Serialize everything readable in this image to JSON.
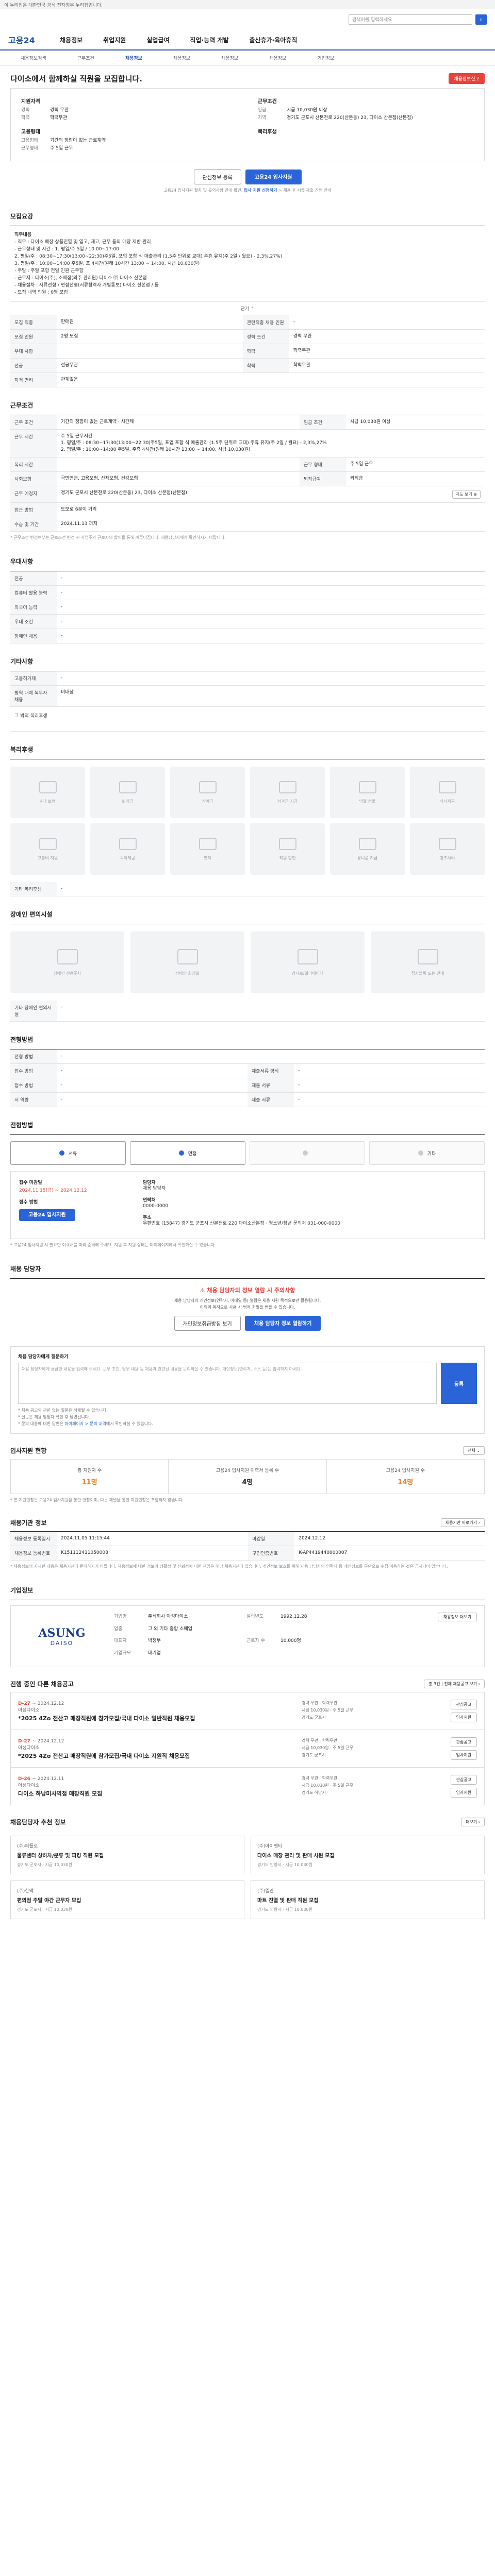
{
  "topbar": {
    "notice": "이 누리집은 대한민국 공식 전자정부 누리집입니다."
  },
  "header": {
    "logo": "고용24",
    "search_placeholder": "검색어를 입력하세요",
    "search_icon": "magnifier-icon"
  },
  "gnb": [
    "채용정보",
    "취업지원",
    "실업급여",
    "직업·능력 개발",
    "출산휴가·육아휴직"
  ],
  "subnav": [
    "채용정보검색",
    "근무조건",
    "채용정보",
    "채용정보",
    "채용정보",
    "채용정보",
    "기업정보"
  ],
  "job": {
    "title": "다이소에서 함께하실 직원을 모집합니다.",
    "report_btn": "채용정보신고",
    "summary": {
      "left_title": "지원자격",
      "left": [
        {
          "k": "경력",
          "v": "경력 무관"
        },
        {
          "k": "학력",
          "v": "학력무관"
        }
      ],
      "left2_title": "고용형태",
      "left2": [
        {
          "k": "고용형태",
          "v": "기간의 정함이 없는 근로계약"
        },
        {
          "k": "근무형태",
          "v": "주 5일 근무"
        }
      ],
      "right_title": "근무조건",
      "right": [
        {
          "k": "임금",
          "v": "시급 10,030원 이상"
        },
        {
          "k": "지역",
          "v": "경기도 군포시 산본천로 220(산본동) 23, 다이소 산본점(산본점)"
        }
      ],
      "right2_title": "복리후생",
      "right2": []
    },
    "interest_btn": "관심정보 등록",
    "apply_btn": "고용24 입사지원",
    "note_pre": "고용24 입사지원 절차 및 유의사항 안내 확인. ",
    "note_blue": "입사 지원 신청하기",
    "note_post": " > 채용 후 서류 제출 진행 안내"
  },
  "recruit": {
    "section_title": "모집요강",
    "desc_title": "직무내용",
    "desc": "- 직무 : 다이소 매장 상품진열 및 입고, 재고, 근무 등의 매장 제반 관리\n- 근무형태 및 시간 : 1. 평일/주 5일 / 10:00~17:00\n2. 평일/주 : 08:30~17:30(13:00~22:30)주5일, 포업 포함 식 매출관리 (1.5주 단위로 교대) 주휴 유지(주 2일 / 월요) - 2,3%,27%)\n3. 평일/주 : 10:00~14:00 주5일, 포 4시간(원래 10시간 13:00 ~ 14:00, 시급 10,030원)\n- 주말 : 주말 포함 전일 인원 근무함\n- 근무지 : 다이소(주), 소매점(외주 관리원) 다이소 ㈜ 다이소 산본점\n- 채용절차 : 서류전형 / 면접전형(서류합격자 개별통보) 다이소 산본점 / 등\n- 모집 내역 인원 : 0명 모집",
    "fold_btn": "닫기 ⌃",
    "table": [
      {
        "k": "모집 직종",
        "v": "판매원",
        "k2": "관련직종 채용 인원",
        "v2": "-"
      },
      {
        "k": "모집 인원",
        "v": "2명 모집",
        "k2": "경력 조건",
        "v2": "경력 무관"
      },
      {
        "k": "우대 사항",
        "v": "",
        "k2": "학력",
        "v2": "학력무관"
      },
      {
        "k": "전공",
        "v": "전공무관",
        "k2": "학력",
        "v2": "학력무관"
      },
      {
        "k": "자격 면허",
        "v": "관계없음",
        "k2": "",
        "v2": ""
      }
    ]
  },
  "conditions": {
    "section_title": "근무조건",
    "rows": [
      {
        "k": "근무 조건",
        "v": "기간의 정함이 없는 근로계약 · 시간제",
        "k2": "임금 조건",
        "v2": "시급 10,030원 이상"
      },
      {
        "k": "근무 시간",
        "v": "주 5일 근무시간\n1. 평일/주 : 08:30~17:30(13:00~22:30)주5일, 포업 포함 식 매출관리 (1.5주 단위로 교대) 주휴 유지(주 2일 / 월요) - 2,3%,27%\n2. 평일/주 : 10:00~14:00 주5일, 주휴 4시간(원래 10시간 13:00 ~ 14:00, 시급 10,030원)",
        "k2": "",
        "v2": ""
      },
      {
        "k": "복리 시간",
        "v": "",
        "k2": "근무 형태",
        "v2": "주 5일 근무"
      },
      {
        "k": "사회보험",
        "v": "국민연금, 고용보험, 산재보험, 건강보험",
        "k2": "퇴직급여",
        "v2": "퇴직금"
      },
      {
        "k": "근무 예정지",
        "v": "경기도 군포시 산본천로 220(산본동) 23, 다이소 산본점(산본점)",
        "k2": "",
        "v2": ""
      },
      {
        "k": "접근 방법",
        "v": "도보로 6분이 거리",
        "k2": "",
        "v2": ""
      },
      {
        "k": "수습 및 기간",
        "v": "2024.11.13 까지",
        "k2": "",
        "v2": ""
      }
    ],
    "map_pill": "지도 보기 ⊕",
    "footnote": "* 근무조건 변경여부는 근로조건 변경 시 사업주와 근로자의 합의를 통해 이루어집니다. 채용담당자에게 확인하시기 바랍니다."
  },
  "preferences": {
    "section_title": "우대사항",
    "rows": [
      {
        "k": "전공",
        "v": "-"
      },
      {
        "k": "컴퓨터 활용 능력",
        "v": "-"
      },
      {
        "k": "외국어 능력",
        "v": "-"
      },
      {
        "k": "우대 조건",
        "v": "-"
      },
      {
        "k": "장애인 채용",
        "v": "-"
      }
    ]
  },
  "other": {
    "section_title": "기타사항",
    "rows": [
      {
        "k": "고용허가제",
        "v": "-"
      },
      {
        "k": "병역 대체 복무자 채용",
        "v": "비대상"
      }
    ],
    "extra_label": "그 밖의 복리후생"
  },
  "welfare": {
    "section_title": "복리후생",
    "items": [
      "4대 보험",
      "퇴직금",
      "상여금",
      "성과급 지급",
      "명절 선물",
      "식사제공",
      "교통비 지원",
      "숙박제공",
      "연차",
      "직원 할인",
      "유니폼 지급",
      "경조사비"
    ],
    "other_label": "기타 복리후생",
    "other_value": "-"
  },
  "disability": {
    "section_title": "장애인 편의시설",
    "items": [
      "장애인 전용주차",
      "장애인 화장실",
      "경사로/엘리베이터",
      "점자블록 또는 안내"
    ],
    "other_label": "기타 장애인 편의시설",
    "other_value": "-"
  },
  "process": {
    "section_title": "전형방법",
    "rows": [
      {
        "k": "전형 방법",
        "v": "-"
      },
      {
        "k": "접수 방법",
        "v": "-",
        "k2": "제출서류 양식",
        "v2": "-"
      },
      {
        "k": "접수 방법",
        "v": "-",
        "k2": "제출 서류",
        "v2": "-"
      },
      {
        "k": "서 역량",
        "v": "-",
        "k2": "제출 서류",
        "v2": "-"
      }
    ]
  },
  "apply": {
    "section_title": "전형방법",
    "methods": [
      "서류",
      "면접",
      "",
      "기타"
    ],
    "left_k": "접수 마감일",
    "left_v": "2024.11.15(금) ~ 2024.12.12",
    "left_k2": "접수 방법",
    "right_k": "담당자",
    "right_v": "채용 담당자",
    "right_k2": "연락처",
    "right_v2": "0000-0000",
    "right_k3": "주소",
    "right_v3": "우편번호 (15847) 경기도 군포시 산본천로 220 다이소산본점 · 청소년/청년 문의처 031-000-0000",
    "apply_btn": "고용24 입사지원",
    "footnote": "* 고용24 입사지원 시 필요한 이력서를 미리 준비해 주세요. 지원 후 지원 상태는 마이페이지에서 확인하실 수 있습니다."
  },
  "contact": {
    "section_title": "채용 담당자",
    "alert_head": "⚠ 채용 담당자의 정보 열람 시 주의사항",
    "alert_body": "채용 담당자의 개인정보(연락처, 이메일 등) 열람은 채용 지원 목적으로만 활용됩니다.\n이외의 목적으로 사용 시 법적 처벌을 받을 수 있습니다.",
    "btn_view": "개인정보취급방침 보기",
    "btn_open": "채용 담당자 정보 열람하기",
    "q_label": "채용 담당자에게 질문하기",
    "q_placeholder": "채용 담당자에게 궁금한 내용을 입력해 주세요. 근무 조건, 업무 내용 등 채용과 관련된 내용을 문의하실 수 있습니다. 개인정보(연락처, 주소 등)는 입력하지 마세요.",
    "q_btn": "등록",
    "q_note1": "* 채용 공고와 관련 없는 질문은 삭제될 수 있습니다.",
    "q_note2": "* 질문은 채용 담당자 확인 후 답변됩니다.",
    "q_note3_pre": "* 문의 내용에 대한 답변은 ",
    "q_note3_blue": "마이페이지 > 문의 내역",
    "q_note3_post": "에서 확인하실 수 있습니다."
  },
  "stats": {
    "section_title": "입사지원 현황",
    "pill": "전체 ⌄",
    "cells": [
      {
        "k": "총 지원자 수",
        "v": "11명"
      },
      {
        "k": "고용24 입사지원 이력서 등록 수",
        "v": "4명"
      },
      {
        "k": "고용24 입사지원 수",
        "v": "14명"
      }
    ],
    "footnote": "* 본 지원현황은 고용24 입사지원을 통한 현황이며, 다른 채널을 통한 지원현황은 포함되지 않습니다."
  },
  "meta": {
    "section_title": "채용기관 정보",
    "pill": "채용기관 바로가기 ›",
    "rows": [
      {
        "k": "채용정보 등록일시",
        "v": "2024.11.05 11:15:44",
        "k2": "마감일",
        "v2": "2024.12.12"
      },
      {
        "k": "채용정보 등록번호",
        "v": "K151112411050008",
        "k2": "구인인증번호",
        "v2": "K-AP4419440000007"
      }
    ],
    "footnote": "* 채용정보의 자세한 내용은 채용기관에 문의하시기 바랍니다. 채용정보에 대한 정보의 정확성 및 신뢰성에 대한 책임은 해당 채용기관에 있습니다. 개인정보 보호를 위해 채용 담당자의 연락처 등 개인정보를 무단으로 수집·이용하는 것은 금지되어 있습니다."
  },
  "company": {
    "section_title": "기업정보",
    "logo_big": "ASUNG",
    "logo_sub": "DAISO",
    "grid": [
      {
        "k": "기업명",
        "v": "주식회사 아성다이소",
        "k2": "설립년도",
        "v2": "1992.12.28"
      },
      {
        "k": "업종",
        "v": "그 외 기타 종합 소매업",
        "k2": "",
        "v2": ""
      },
      {
        "k": "대표자",
        "v": "박정부",
        "k2": "근로자 수",
        "v2": "10,000명"
      },
      {
        "k": "기업규모",
        "v": "대기업",
        "k2": "",
        "v2": ""
      }
    ],
    "btn": "채용정보 더보기"
  },
  "joblist": {
    "section_title": "진행 중인 다른 채용공고",
    "pill": "총 3건 | 전체 채용공고 보기 ›",
    "items": [
      {
        "dday": "D-27",
        "date": "~ 2024.12.12",
        "company": "아성다이소",
        "title": "*2025 4Zo 전산고 매장직원에 참가모집/국내 다이소 일반직원 채용모집",
        "meta1": "경력 무관 · 학력무관",
        "meta2": "시급 10,030원 · 주 5일 근무",
        "meta3": "경기도 군포시",
        "btn1": "관심공고",
        "btn2": "입사지원"
      },
      {
        "dday": "D-27",
        "date": "~ 2024.12.12",
        "company": "아성다이소",
        "title": "*2025 4Zo 전산고 매장직원에 참가모집/국내 다이소 지원직 채용모집",
        "meta1": "경력 무관 · 학력무관",
        "meta2": "시급 10,030원 · 주 5일 근무",
        "meta3": "경기도 군포시",
        "btn1": "관심공고",
        "btn2": "입사지원"
      },
      {
        "dday": "D-26",
        "date": "~ 2024.12.11",
        "company": "아성다이소",
        "title": "다이소 하남미사역점 매장직원 모집",
        "meta1": "경력 무관 · 학력무관",
        "meta2": "시급 10,030원 · 주 5일 근무",
        "meta3": "경기도 하남시",
        "btn1": "관심공고",
        "btn2": "입사지원"
      }
    ]
  },
  "reco": {
    "section_title": "채용담당자 추천 정보",
    "pill": "더보기 ›",
    "items": [
      {
        "n": "(주)퍼플로",
        "t": "물류센터 상하차/분류 및 피킹 직원 모집",
        "meta": "경기도 군포시 · 시급 10,030원"
      },
      {
        "n": "(주)아이앤티",
        "t": "다이소 매장 관리 및 판매 사원 모집",
        "meta": "경기도 안양시 · 시급 10,030원"
      },
      {
        "n": "(주)한맥",
        "t": "편의점 주말 야간 근무자 모집",
        "meta": "경기도 군포시 · 시급 10,030원"
      },
      {
        "n": "(주)엘엔",
        "t": "마트 진열 및 판매 직원 모집",
        "meta": "경기도 의왕시 · 시급 10,030원"
      }
    ]
  }
}
